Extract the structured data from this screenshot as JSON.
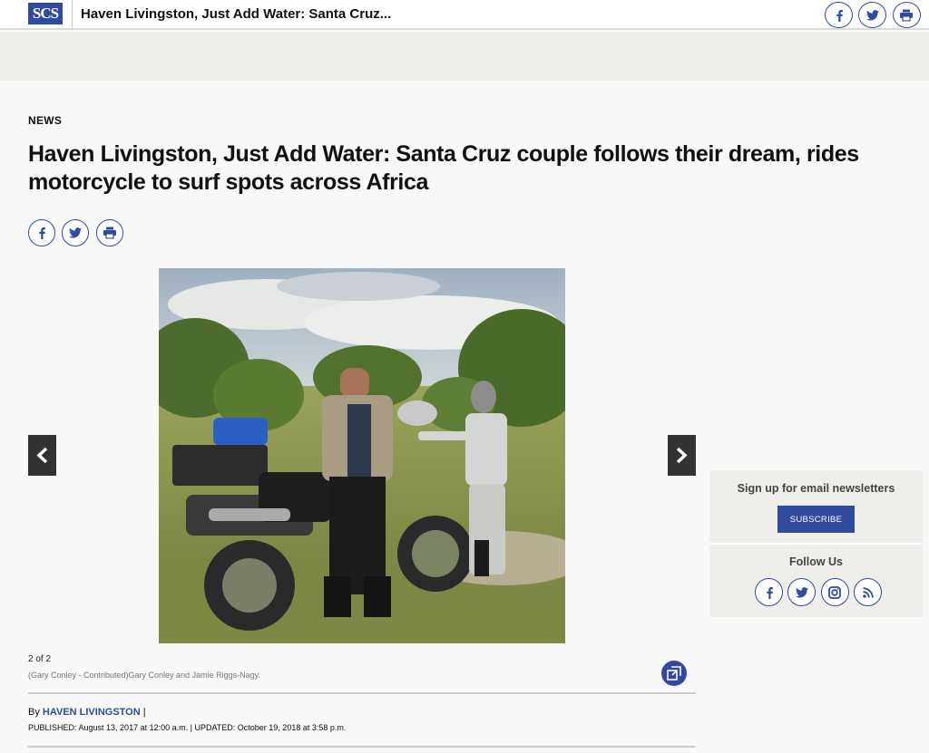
{
  "header": {
    "logo_text": "SCS",
    "title": "Haven Livingston, Just Add Water: Santa Cruz...",
    "share_icons": [
      "facebook-icon",
      "twitter-icon",
      "print-icon"
    ]
  },
  "article": {
    "section": "NEWS",
    "headline": "Haven Livingston, Just Add Water: Santa Cruz couple follows their dream, rides motorcycle to surf spots across Africa",
    "share_icons": [
      "facebook-icon",
      "twitter-icon",
      "print-icon"
    ]
  },
  "gallery": {
    "counter": "2 of 2",
    "caption": "(Gary Conley - Contributed)Gary Conley and Jamie Riggs-Nagy."
  },
  "byline": {
    "prefix": "By",
    "author": "HAVEN LIVINGSTON",
    "separator": "|",
    "published_text": "PUBLISHED: August 13, 2017 at 12:00 a.m. | UPDATED: October 19, 2018 at 3:58 p.m."
  },
  "sidebar": {
    "newsletter_heading": "Sign up for email newsletters",
    "subscribe_label": "SUBSCRIBE",
    "follow_heading": "Follow Us",
    "follow_icons": [
      "facebook-icon",
      "twitter-icon",
      "instagram-icon",
      "rss-icon"
    ]
  },
  "colors": {
    "brand": "#2f4a9e",
    "background": "#f8f8f8",
    "band": "#efeeea"
  }
}
